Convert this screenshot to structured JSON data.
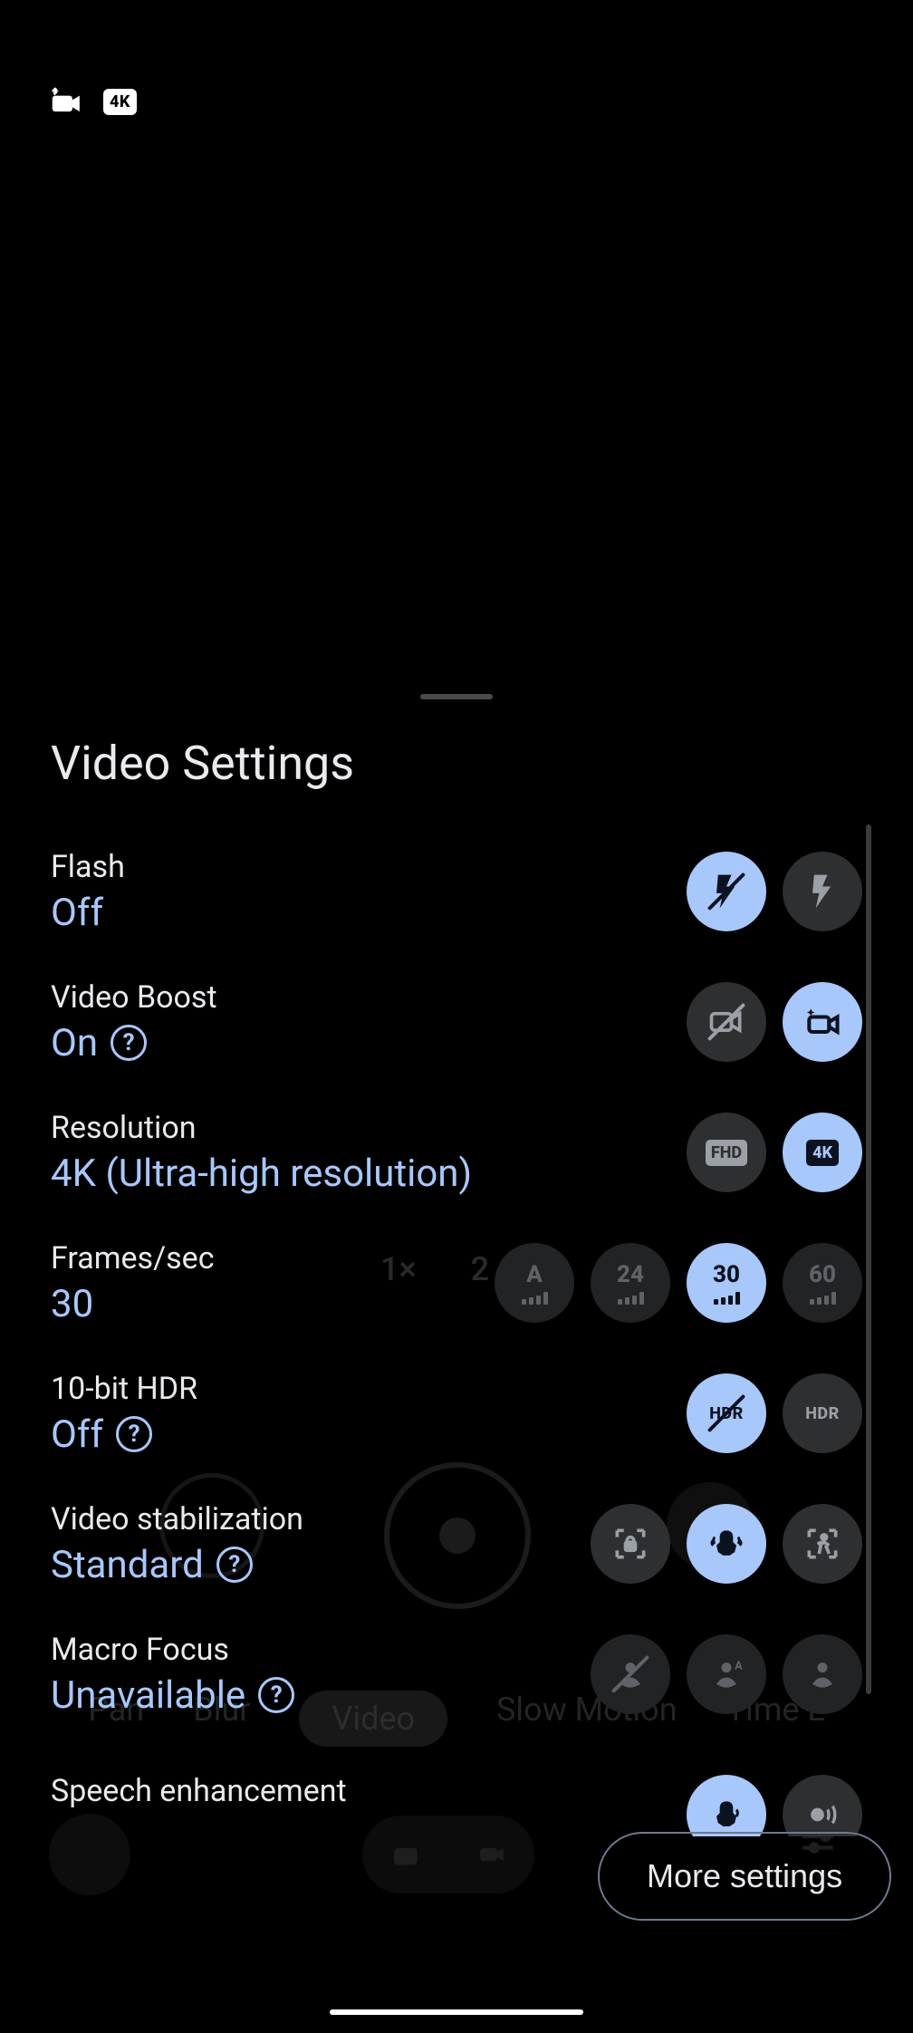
{
  "topbar": {
    "videoboost_icon": "video-boost-icon",
    "resolution_badge": "4K"
  },
  "panel": {
    "title": "Video Settings"
  },
  "settings": {
    "flash": {
      "label": "Flash",
      "value": "Off"
    },
    "videoBoost": {
      "label": "Video Boost",
      "value": "On"
    },
    "resolution": {
      "label": "Resolution",
      "value": "4K (Ultra-high resolution)"
    },
    "fps": {
      "label": "Frames/sec",
      "value": "30"
    },
    "hdr": {
      "label": "10-bit HDR",
      "value": "Off"
    },
    "stab": {
      "label": "Video stabilization",
      "value": "Standard"
    },
    "macro": {
      "label": "Macro Focus",
      "value": "Unavailable"
    },
    "speech": {
      "label": "Speech enhancement"
    }
  },
  "options": {
    "resolution": {
      "fhd": "FHD",
      "k4": "4K"
    },
    "fps": {
      "auto": "A",
      "v24": "24",
      "v30": "30",
      "v60": "60"
    },
    "hdr_label": "HDR"
  },
  "footer": {
    "more": "More settings"
  },
  "bg_modes": {
    "pan": "Pan",
    "blur": "Blur",
    "video": "Video",
    "slowmo": "Slow Motion",
    "timelapse": "Time L"
  },
  "bg_zoom": {
    "one": "1×",
    "two": "2"
  }
}
